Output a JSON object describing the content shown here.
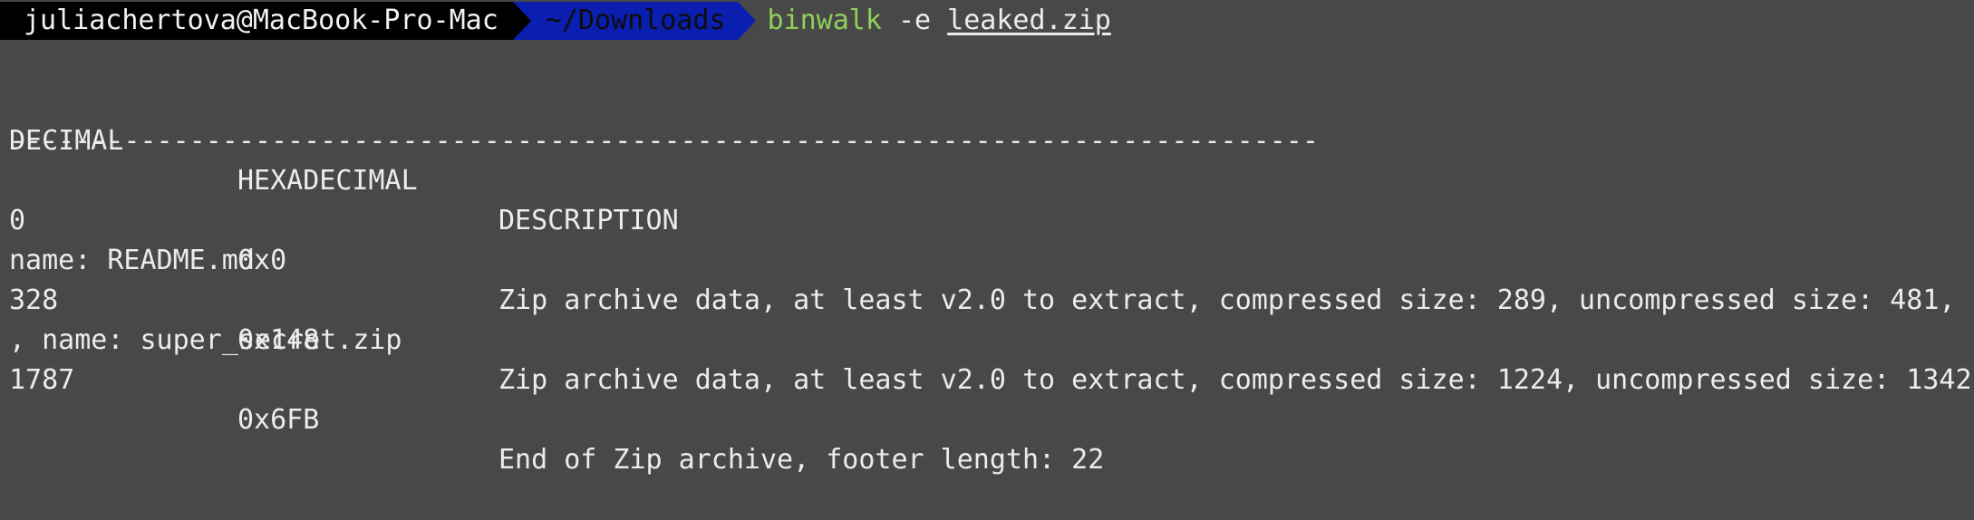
{
  "prompt": {
    "user_host": "juliachertova@MacBook-Pro-Mac",
    "directory": "~/Downloads",
    "command": "binwalk",
    "flag": "-e",
    "file": "leaked.zip"
  },
  "table": {
    "headers": {
      "decimal": "DECIMAL",
      "hexadecimal": "HEXADECIMAL",
      "description": "DESCRIPTION"
    },
    "divider": "--------------------------------------------------------------------------------",
    "rows": [
      {
        "decimal": "0",
        "hexadecimal": "0x0",
        "description": "Zip archive data, at least v2.0 to extract, compressed size: 289, uncompressed size: 481,",
        "continuation": "name: README.md"
      },
      {
        "decimal": "328",
        "hexadecimal": "0x148",
        "description": "Zip archive data, at least v2.0 to extract, compressed size: 1224, uncompressed size: 1342",
        "continuation": ", name: super_secret.zip"
      },
      {
        "decimal": "1787",
        "hexadecimal": "0x6FB",
        "description": "End of Zip archive, footer length: 22",
        "continuation": ""
      }
    ]
  },
  "colors": {
    "background": "#484848",
    "user_segment": "#000000",
    "dir_segment": "#0a1fb0",
    "command": "#8fd05a"
  }
}
